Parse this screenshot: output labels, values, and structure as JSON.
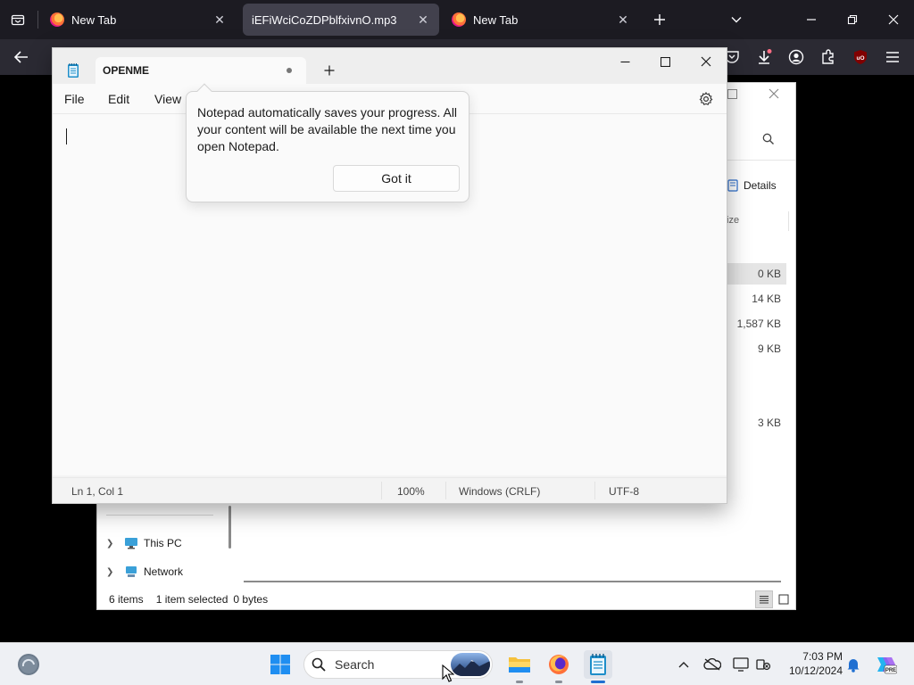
{
  "firefox": {
    "tabs": [
      {
        "title": "New Tab",
        "active": false
      },
      {
        "title": "iEFiWciCoZDPblfxivnO.mp3",
        "active": true
      },
      {
        "title": "New Tab",
        "active": false
      }
    ],
    "icons": [
      "tab-list-icon",
      "firefox-logo-icon",
      "close-icon",
      "plus-icon",
      "chevron-down-icon",
      "minimize-icon",
      "restore-icon",
      "back-arrow-icon",
      "pocket-icon",
      "download-icon",
      "account-icon",
      "extensions-icon",
      "ublock-origin-icon",
      "hamburger-menu-icon"
    ],
    "ublock_label": "uO",
    "accent": "#ff7139"
  },
  "explorer": {
    "details_label": "Details",
    "size_header": "ize",
    "sizes": [
      "0 KB",
      "14 KB",
      "1,587 KB",
      "9 KB",
      "3 KB"
    ],
    "nav": [
      {
        "label": "This PC",
        "icon": "monitor-icon"
      },
      {
        "label": "Network",
        "icon": "network-icon"
      }
    ],
    "status": {
      "items": "6 items",
      "selected": "1 item selected",
      "size": "0 bytes"
    }
  },
  "notepad": {
    "tab_title": "OPENME",
    "menu": [
      "File",
      "Edit",
      "View"
    ],
    "tip": {
      "text": "Notepad automatically saves your progress. All your content will be available the next time you open Notepad.",
      "button": "Got it"
    },
    "status": {
      "position": "Ln 1, Col 1",
      "zoom": "100%",
      "line_ending": "Windows (CRLF)",
      "encoding": "UTF-8"
    }
  },
  "taskbar": {
    "search_placeholder": "Search",
    "time": "7:03 PM",
    "date": "10/12/2024",
    "copilot_badge": "PRE",
    "apps": [
      "windows-start-icon",
      "file-explorer-icon",
      "firefox-icon",
      "notepad-icon"
    ],
    "tray": [
      "chevron-up-icon",
      "onedrive-icon",
      "display-icon",
      "network-status-icon",
      "notification-bell-icon",
      "copilot-icon"
    ]
  }
}
